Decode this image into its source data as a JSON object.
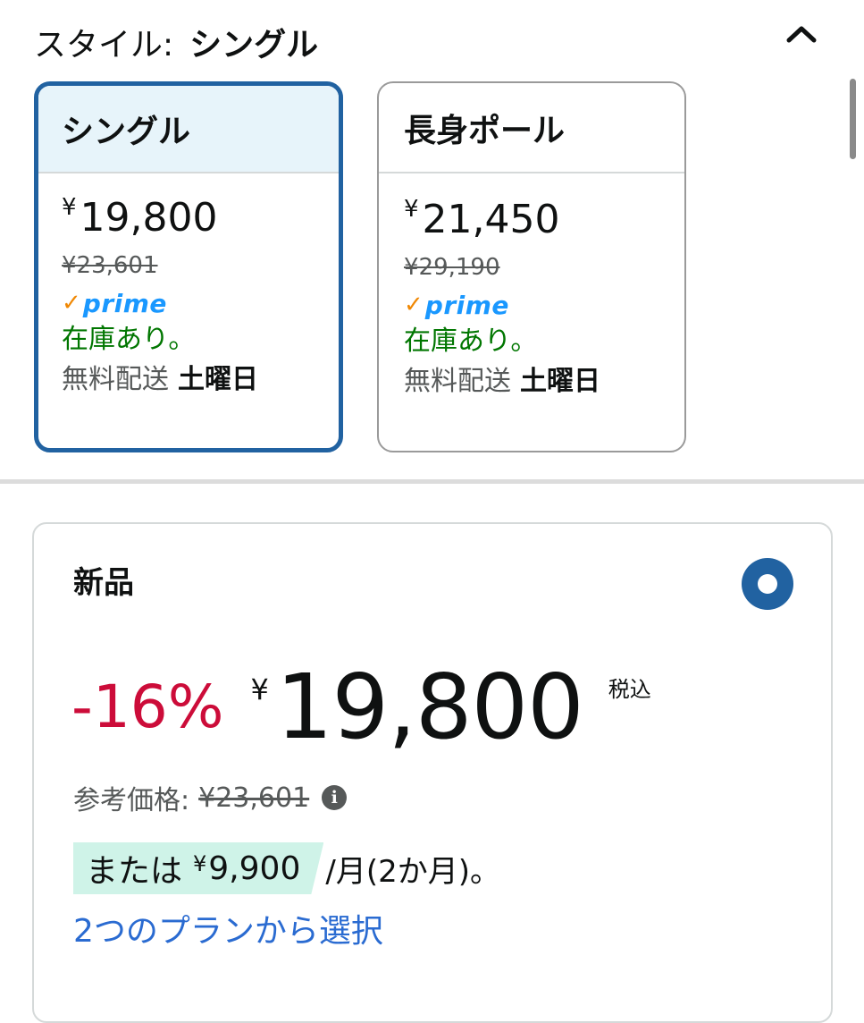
{
  "style_selector": {
    "label": "スタイル:",
    "selected_value": "シングル",
    "collapse_icon": "chevron-up-icon"
  },
  "options": [
    {
      "name": "シングル",
      "selected": true,
      "yen": "¥",
      "price": "19,800",
      "list_price": "¥23,601",
      "prime_check": "✓",
      "prime": "prime",
      "stock": "在庫あり。",
      "ship_label": "無料配送",
      "ship_day": "土曜日"
    },
    {
      "name": "長身ポール",
      "selected": false,
      "yen": "¥",
      "price": "21,450",
      "list_price": "¥29,190",
      "prime_check": "✓",
      "prime": "prime",
      "stock": "在庫あり。",
      "ship_label": "無料配送",
      "ship_day": "土曜日"
    }
  ],
  "offer": {
    "title": "新品",
    "discount": "-16%",
    "yen": "¥",
    "price": "19,800",
    "tax_note": "税込",
    "ref_label": "参考価格:",
    "ref_price": "¥23,601",
    "info_glyph": "i",
    "installment_prefix": "または",
    "installment_yen": "¥",
    "installment_amount": "9,900",
    "installment_suffix": "/月(2か月)。",
    "plan_link": "2つのプランから選択"
  },
  "colors": {
    "accent": "#2162a1",
    "selected_bg": "#e7f4fa",
    "discount": "#cc0c39",
    "in_stock": "#007600",
    "prime_check": "#f08804",
    "prime_text": "#1a98ff",
    "installment_bg": "#cff3e8",
    "link": "#2a6bd1"
  }
}
